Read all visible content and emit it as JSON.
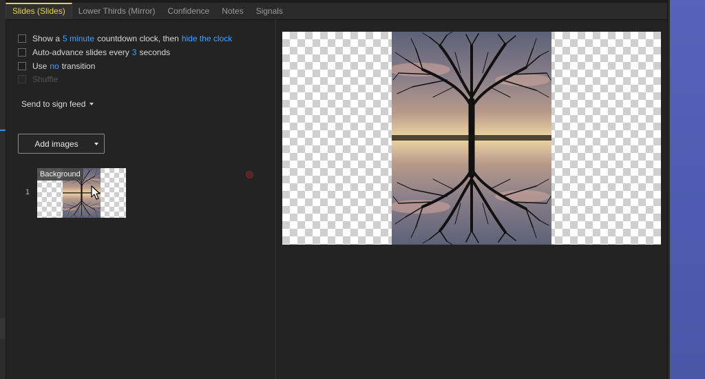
{
  "tabs": [
    {
      "label": "Slides (Slides)",
      "active": true
    },
    {
      "label": "Lower Thirds (Mirror)",
      "active": false
    },
    {
      "label": "Confidence",
      "active": false
    },
    {
      "label": "Notes",
      "active": false
    },
    {
      "label": "Signals",
      "active": false
    }
  ],
  "options": {
    "countdown": {
      "pre": "Show a",
      "link1": "5 minute",
      "mid": "countdown clock, then",
      "link2": "hide the clock",
      "checked": false
    },
    "autoadvance": {
      "pre": "Auto-advance slides every",
      "link": "3",
      "post": "seconds",
      "checked": false
    },
    "transition": {
      "pre": "Use",
      "link": "no",
      "post": "transition",
      "checked": false
    },
    "shuffle": {
      "label": "Shuffle",
      "enabled": false
    }
  },
  "send_feed": {
    "label": "Send to sign feed"
  },
  "add_images": {
    "label": "Add images"
  },
  "slides": [
    {
      "index": "1",
      "label": "Background"
    }
  ],
  "icons": {
    "cursor": "mouse-pointer-icon",
    "dropdown": "chevron-down-icon"
  },
  "colors": {
    "accent_tab": "#e9d63c",
    "link": "#3ea2ff",
    "background": "#232323"
  }
}
